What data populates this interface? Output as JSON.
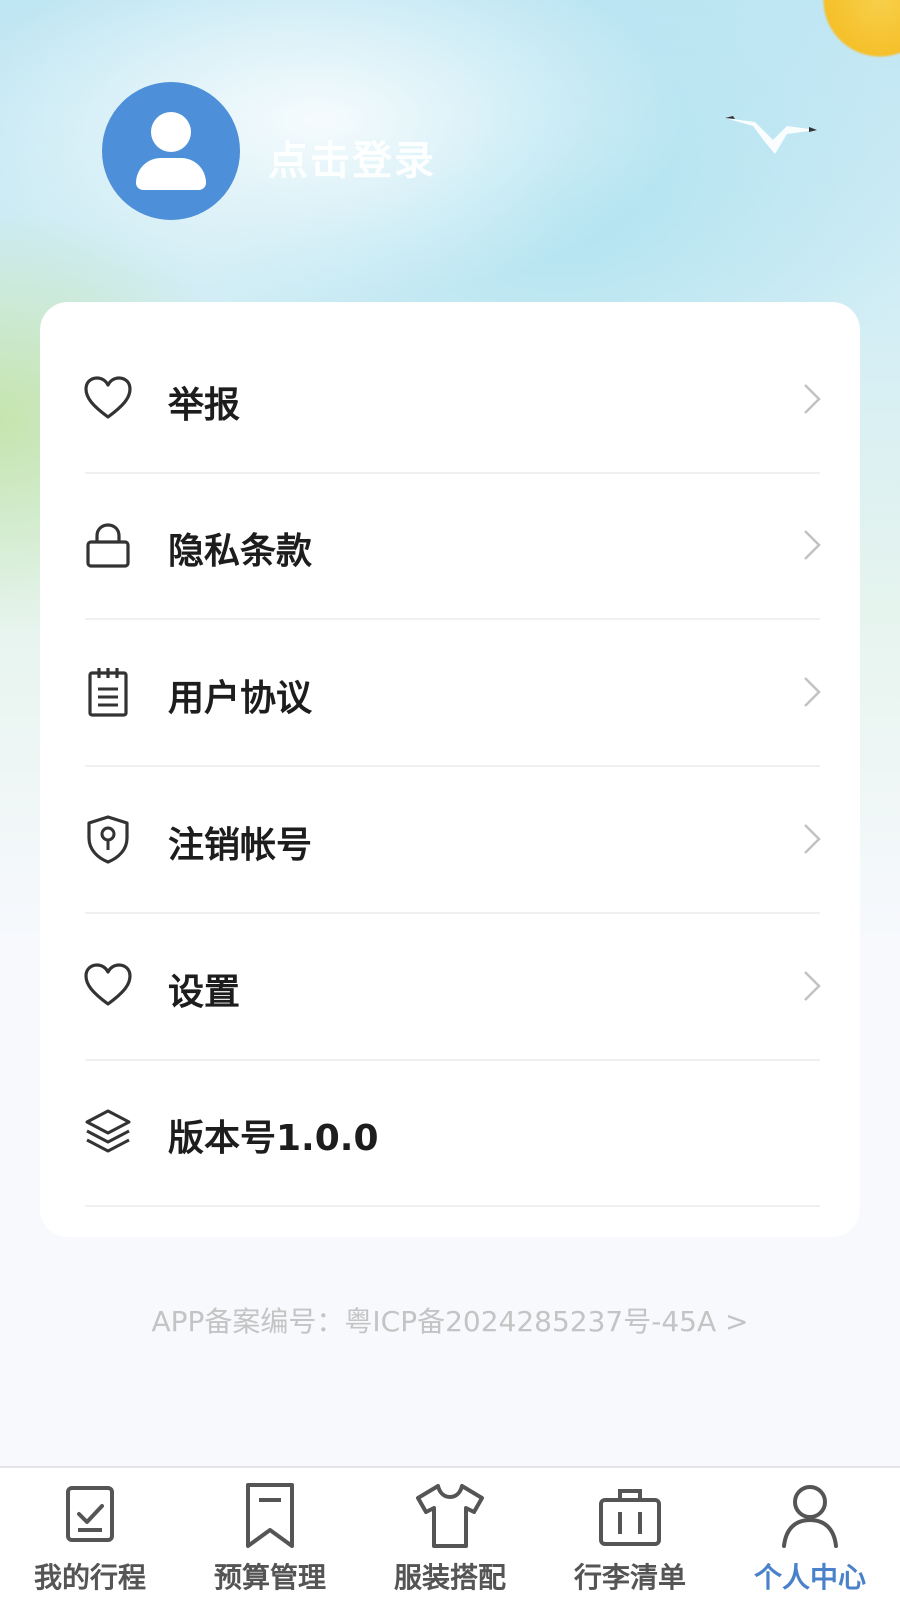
{
  "header": {
    "login_text": "点击登录",
    "avatar_icon": "user-avatar-icon"
  },
  "menu": {
    "items": [
      {
        "label": "举报",
        "icon": "heart-icon"
      },
      {
        "label": "隐私条款",
        "icon": "lock-icon"
      },
      {
        "label": "用户协议",
        "icon": "document-icon"
      },
      {
        "label": "注销帐号",
        "icon": "shield-key-icon"
      },
      {
        "label": "设置",
        "icon": "heart-icon"
      },
      {
        "label": "版本号1.0.0",
        "icon": "layers-icon"
      }
    ]
  },
  "footer": {
    "icp_text": "APP备案编号：粤ICP备2024285237号-45A >"
  },
  "tabbar": {
    "tabs": [
      {
        "label": "我的行程",
        "icon": "checklist-icon",
        "active": false
      },
      {
        "label": "预算管理",
        "icon": "bookmark-icon",
        "active": false
      },
      {
        "label": "服装搭配",
        "icon": "tshirt-icon",
        "active": false
      },
      {
        "label": "行李清单",
        "icon": "suitcase-icon",
        "active": false
      },
      {
        "label": "个人中心",
        "icon": "person-icon",
        "active": true
      }
    ]
  },
  "colors": {
    "accent": "#4a82c9",
    "avatar_bg": "#4d8fd8"
  }
}
